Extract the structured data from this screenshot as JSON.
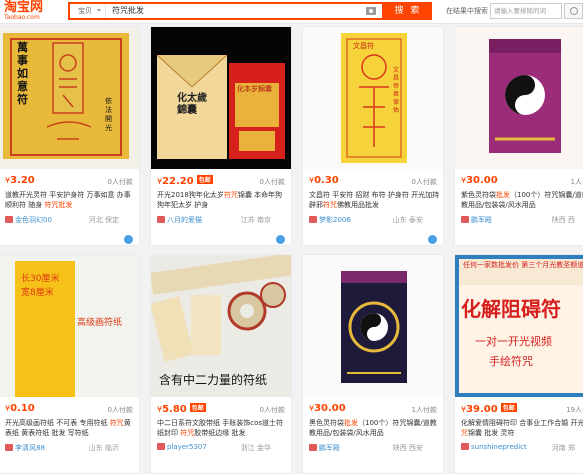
{
  "header": {
    "logo_cn": "淘宝网",
    "logo_en": "Taobao.com",
    "category": "宝贝",
    "query": "符咒批发",
    "search_label": "搜 索",
    "result_search_label": "在结果中搜索",
    "result_placeholder": "请输入要排除的词"
  },
  "accent_color": "#ff4400",
  "products": [
    {
      "price": "3.20",
      "paid": "0人付款",
      "title_a": "道教开光灵符 平安护身符 万事如意 办事顺利符 随身 ",
      "title_hl": "符咒批发",
      "title_b": "",
      "shop": "金色羽幻00",
      "loc": "河北 保定",
      "badge": ""
    },
    {
      "price": "22.20",
      "paid": "0人付款",
      "title_a": "开光2018狗年化太岁",
      "title_hl": "符咒",
      "title_b": "锦囊 本命年狗 狗年犯太岁 护身",
      "shop": "八月的爱猫",
      "loc": "江苏 南京",
      "badge": "包邮"
    },
    {
      "price": "0.30",
      "paid": "0人付款",
      "title_a": "文昌符 平安符 招财 布符 护身符 开光加持辟邪",
      "title_hl": "符咒",
      "title_b": "佛教用品批发",
      "shop": "梦影2006",
      "loc": "山东 泰安",
      "badge": ""
    },
    {
      "price": "30.00",
      "paid": "1人付",
      "title_a": "紫色灵符袋",
      "title_hl": "批发",
      "title_b": "（100个）符咒锦囊/道教教用品/包装袋/风水用品",
      "shop": "鹏军殿",
      "loc": "陕西 西",
      "badge": ""
    },
    {
      "price": "0.10",
      "paid": "0人付款",
      "title_a": "开光高级画符纸 不可表 专用符纸 ",
      "title_hl": "符咒",
      "title_b": "黄表纸 黄表符纸 批发 写符纸",
      "shop": "李清风88",
      "loc": "山东 临沂",
      "badge": ""
    },
    {
      "price": "5.80",
      "paid": "0人付款",
      "title_a": "中二日系符文胶带纸 手账装饰cos道士符纸封印 ",
      "title_hl": "符咒",
      "title_b": "胶带纸边缘 批发",
      "shop": "player5307",
      "loc": "浙江 金华",
      "badge": "包邮"
    },
    {
      "price": "30.00",
      "paid": "1人付款",
      "title_a": "黑色灵符袋",
      "title_hl": "批发",
      "title_b": "（100个）符咒锦囊/道教教用品/包装袋/风水用品",
      "shop": "鹏军殿",
      "loc": "陕西 西安",
      "badge": ""
    },
    {
      "price": "39.00",
      "paid": "19人付",
      "title_a": "化解爱情阻碍符印 合事业工作合婚 开光",
      "title_hl": "符咒",
      "title_b": "锦囊 批发 灵符",
      "shop": "sunshinepredict",
      "loc": "河南 郑",
      "badge": "包邮"
    }
  ],
  "images": {
    "p1": {
      "col1": "萬事如意符",
      "col2": "依法開光"
    },
    "p2": {
      "envelope": "化太歲錦囊",
      "label": "化本岁錦囊"
    },
    "p3": {
      "top": "文昌符",
      "main": "文昌帝君保佑"
    },
    "p5": {
      "size1": "长30厘米",
      "size2": "宽8厘米",
      "name": "高级画符纸"
    },
    "p6": {
      "caption": "含有中二力量的符纸"
    },
    "p8": {
      "line1": "任何一家数批发价 第三个月光教圣额道",
      "main": "化解阻碍符",
      "line2": "一对一开光视频",
      "line3": "手绘符咒"
    }
  }
}
